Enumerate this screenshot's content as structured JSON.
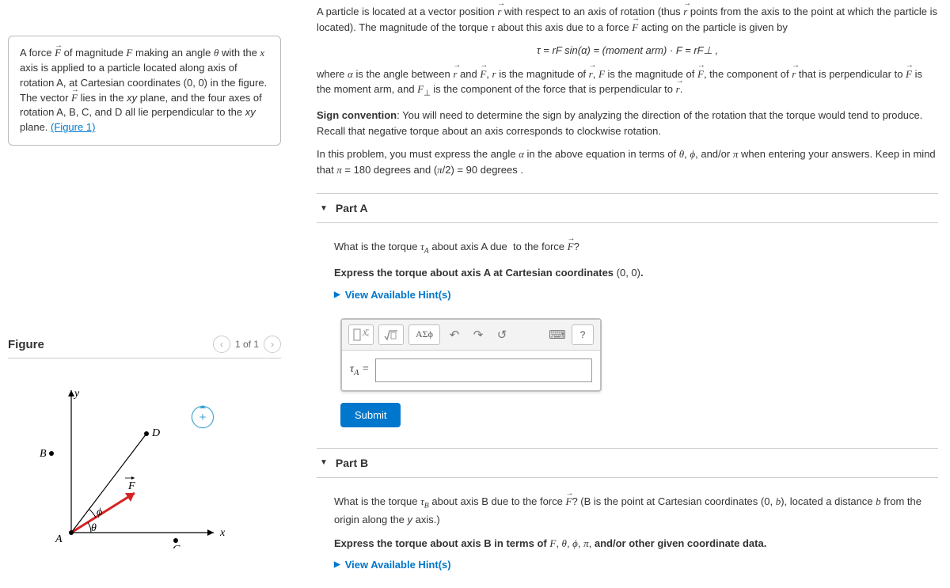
{
  "left": {
    "info_html": "A force <span class='vec'>F</span> of magnitude <i class='v'>F</i> making an angle <i class='v'>θ</i> with the <i class='v'>x</i> axis is applied to a particle located along axis of rotation A, at Cartesian coordinates (0, 0) in the figure. The vector <span class='vec'>F</span> lies in the <i>xy</i> plane, and the four axes of rotation A, B, C, and D all lie perpendicular to the <i>xy</i> plane. ",
    "figure_link": "(Figure 1)",
    "figure_title": "Figure",
    "figure_counter": "1 of 1",
    "labels": {
      "A": "A",
      "B": "B",
      "C": "C",
      "D": "D",
      "x": "x",
      "y": "y",
      "F": "F",
      "theta": "θ",
      "phi": "ϕ"
    }
  },
  "intro": {
    "p1_html": "A particle is located at a vector position <span class='vec'>r</span> with respect to an axis of rotation (thus <span class='vec'>r</span> points from the axis to the point at which the particle is located). The magnitude of the torque <i class='v'>τ</i> about this axis due to a force <span class='vec'>F</span> acting on the particle is given by",
    "formula": "τ = rF sin(α) = (moment arm) · F = rF⊥ ,",
    "p2_html": "where <i class='v'>α</i> is the angle between <span class='vec'>r</span> and <span class='vec'>F</span>, <i class='v'>r</i> is the magnitude of <span class='vec'>r</span>, <i class='v'>F</i> is the magnitude of <span class='vec'>F</span>, the component of <span class='vec'>r</span> that is perpendicular to <span class='vec'>F</span> is the moment arm, and <i class='v'>F</i><span class='sub'>⊥</span> is the component of the force that is perpendicular to <span class='vec'>r</span>.",
    "p3_html": "<b>Sign convention</b>: You will need to determine the sign by analyzing the direction of the rotation that the torque would tend to produce. Recall that negative torque about an axis corresponds to clockwise rotation.",
    "p4_html": "In this problem, you must express the angle <i class='v'>α</i> in the above equation in terms of <i class='v'>θ</i>, <i class='v'>ϕ</i>, and/or <i class='v'>π</i> when entering your answers. Keep in mind that <i class='v'>π</i> = 180 degrees and (<i class='v'>π</i>/2) = 90 degrees ."
  },
  "partA": {
    "title": "Part A",
    "q1_html": "What is the torque <i class='v'>τ<span class='sub'>A</span></i> about axis A due &nbsp;to the force <span class='vec'>F</span>?",
    "q2_html": "<b>Express the torque about axis A at Cartesian coordinates</b> (0, 0)<b>.</b>",
    "hints": "View Available Hint(s)",
    "answer_label": "τA =",
    "submit": "Submit",
    "tool_greek": "ΑΣϕ",
    "tool_q": "?"
  },
  "partB": {
    "title": "Part B",
    "q1_html": "What is the torque <i class='v'>τ<span class='sub'>B</span></i> about axis B due to the force <span class='vec'>F</span>? (B is the point at Cartesian coordinates (0, <i class='v'>b</i>), located a distance <i class='v'>b</i> from the origin along the <i>y</i> axis.)",
    "q2_html": "<b>Express the torque about axis B in terms of</b> <i class='v'>F</i>, <i class='v'>θ</i>, <i class='v'>ϕ</i>, <i class='v'>π</i>, <b>and/or other given coordinate data.</b>",
    "hints": "View Available Hint(s)"
  }
}
